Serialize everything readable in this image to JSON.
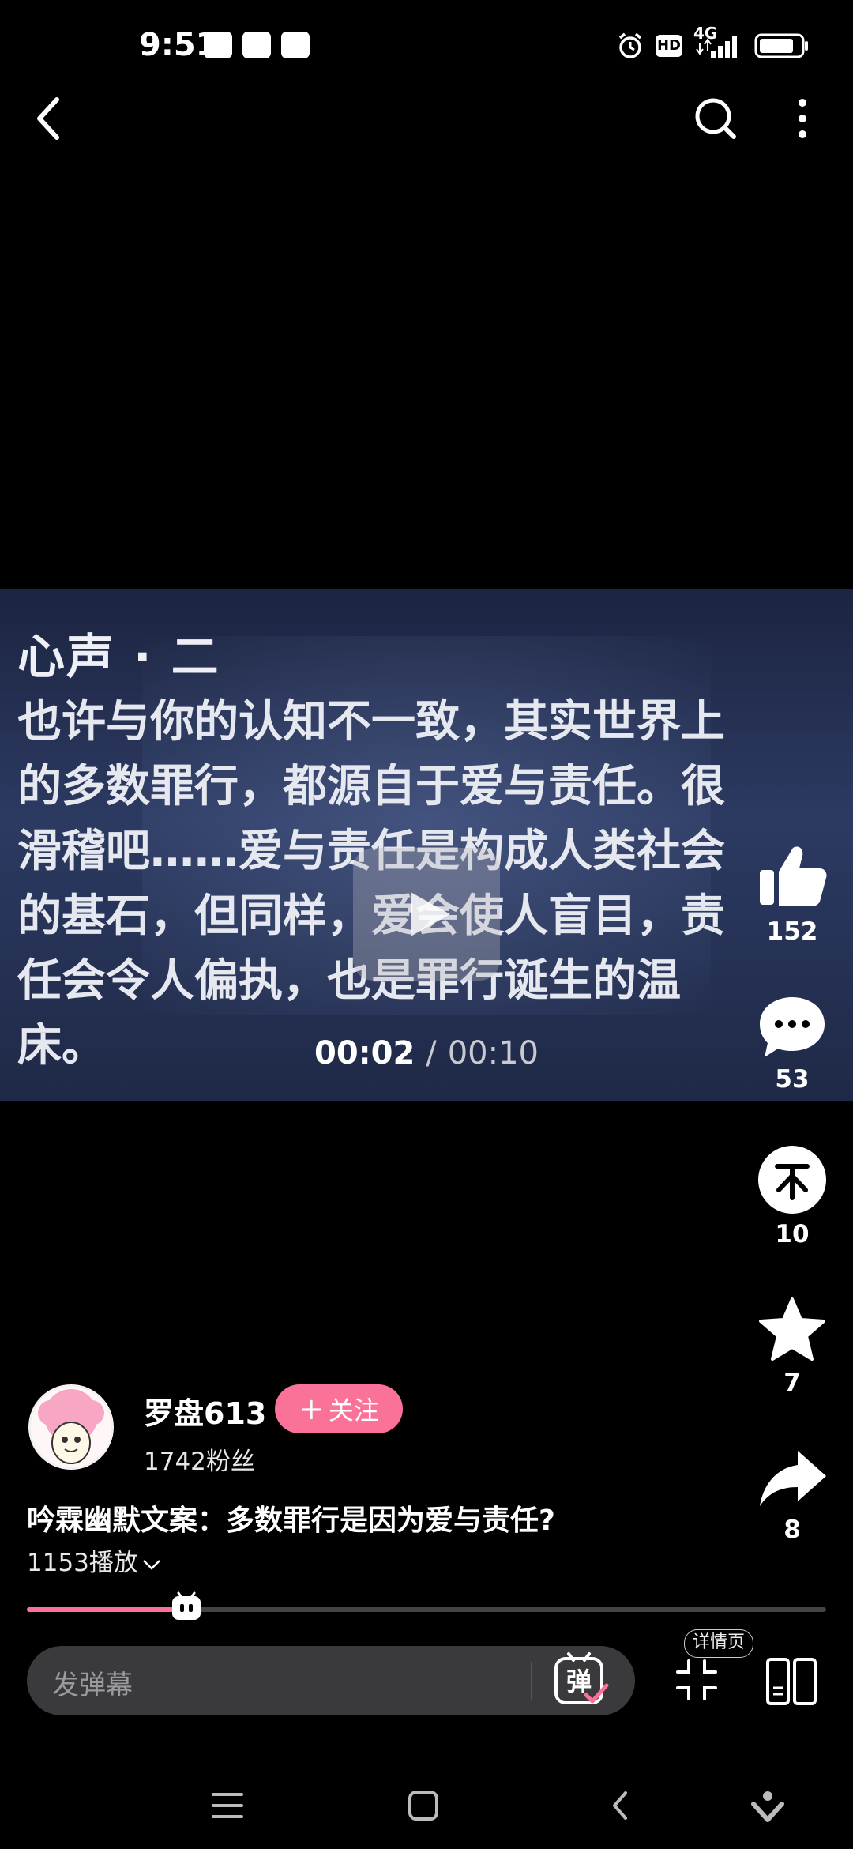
{
  "status": {
    "time": "9:51",
    "network": "4G",
    "hd": "HD"
  },
  "video": {
    "title_text": "心声 · 二",
    "body_lines": [
      "也许与你的认知不一致，其实世界上",
      "的多数罪行，都源自于爱与责任。很",
      "滑稽吧……爱与责任是构成人类社会",
      "的基石，但同样，爱会使人盲目，责",
      "任会令人偏执，也是罪行诞生的温",
      "床。"
    ],
    "time_current": "00:02",
    "time_separator": "/",
    "time_total": "00:10"
  },
  "actions": {
    "like_count": "152",
    "comment_count": "53",
    "coin_count": "10",
    "favorite_count": "7",
    "share_count": "8"
  },
  "uploader": {
    "name": "罗盘613",
    "follow_label": "关注",
    "fans": "1742粉丝"
  },
  "video_info": {
    "title": "吟霖幽默文案：多数罪行是因为爱与责任?",
    "plays": "1153播放"
  },
  "progress": {
    "fraction": 0.2
  },
  "bottom": {
    "danmaku_placeholder": "发弹幕",
    "danmaku_toggle_label": "弹",
    "detail_label": "详情页"
  },
  "colors": {
    "accent": "#fb7299",
    "background": "#000000",
    "input_bg": "#3a3a3c"
  }
}
